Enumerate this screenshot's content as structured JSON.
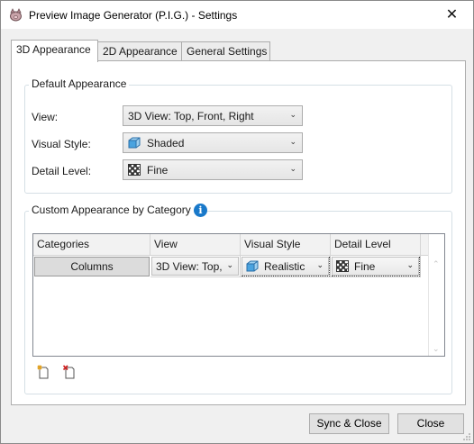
{
  "window": {
    "title": "Preview Image Generator (P.I.G.) - Settings",
    "close_glyph": "✕"
  },
  "tabs": [
    {
      "label": "3D Appearance",
      "active": true
    },
    {
      "label": "2D Appearance",
      "active": false
    },
    {
      "label": "General Settings",
      "active": false
    }
  ],
  "default_appearance": {
    "title": "Default Appearance",
    "view": {
      "label": "View:",
      "value": "3D View: Top, Front, Right"
    },
    "visual_style": {
      "label": "Visual Style:",
      "value": "Shaded",
      "icon": "shaded-cube-icon"
    },
    "detail_level": {
      "label": "Detail Level:",
      "value": "Fine",
      "icon": "fine-detail-icon"
    }
  },
  "custom_appearance": {
    "title": "Custom Appearance by Category",
    "info_glyph": "i",
    "columns": [
      "Categories",
      "View",
      "Visual Style",
      "Detail Level"
    ],
    "rows": [
      {
        "category": "Columns",
        "view": "3D View: Top,",
        "visual_style": "Realistic",
        "detail_level": "Fine"
      }
    ],
    "tools": [
      "add-row-icon",
      "delete-row-icon"
    ]
  },
  "footer": {
    "sync_close_label": "Sync & Close",
    "close_label": "Close"
  },
  "colors": {
    "info_blue": "#1979ca",
    "cube_blue": "#4aa3df"
  }
}
